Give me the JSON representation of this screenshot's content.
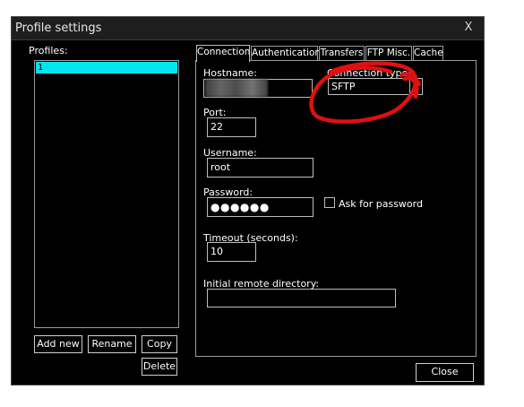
{
  "window": {
    "title": "Profile settings",
    "close_label": "X"
  },
  "profiles": {
    "label": "Profiles:",
    "items": [
      "1"
    ],
    "buttons": {
      "add_new": "Add new",
      "rename": "Rename",
      "copy": "Copy",
      "delete": "Delete"
    }
  },
  "tabs": [
    "Connection",
    "Authentication",
    "Transfers",
    "FTP Misc.",
    "Cache"
  ],
  "connection": {
    "hostname_label": "Hostname:",
    "hostname_value": "",
    "connection_type_label": "Connection type:",
    "connection_type_value": "SFTP",
    "port_label": "Port:",
    "port_value": "22",
    "username_label": "Username:",
    "username_value": "root",
    "password_label": "Password:",
    "password_value": "●●●●●●",
    "ask_password_label": "Ask for password",
    "timeout_label": "Timeout (seconds):",
    "timeout_value": "10",
    "remote_dir_label": "Initial remote directory:",
    "remote_dir_value": ""
  },
  "footer": {
    "close_label": "Close"
  },
  "colors": {
    "accent_selection": "#00e5ee",
    "annotation": "#e01010"
  }
}
